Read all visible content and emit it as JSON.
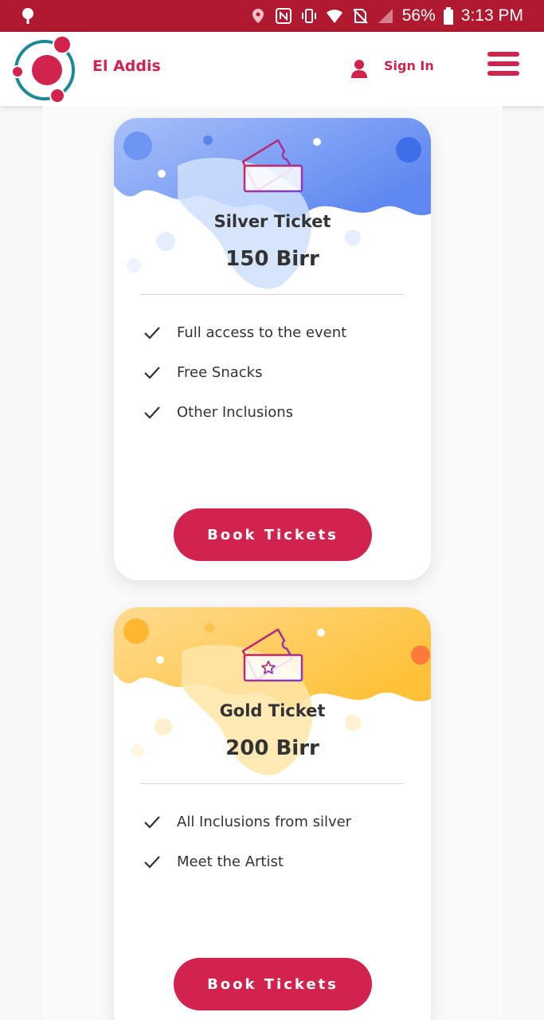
{
  "status_bar": {
    "battery": "56%",
    "time": "3:13 PM",
    "icons": [
      "pin-icon",
      "location-icon",
      "nfc-icon",
      "vibrate-icon",
      "wifi-icon",
      "no-sim-icon",
      "signal-icon",
      "battery-icon"
    ]
  },
  "navbar": {
    "brand": "El Addis",
    "sign_in": "Sign In",
    "icons": [
      "logo-icon",
      "user-icon",
      "hamburger-menu-icon"
    ]
  },
  "tickets": [
    {
      "title": "Silver Ticket",
      "price": "150 Birr",
      "features": [
        "Full access to the event",
        "Free Snacks",
        "Other Inclusions"
      ],
      "button": "Book Tickets",
      "theme": "blue",
      "icon": "ticket-icon"
    },
    {
      "title": "Gold Ticket",
      "price": "200 Birr",
      "features": [
        "All Inclusions from silver",
        "Meet the Artist"
      ],
      "button": "Book Tickets",
      "theme": "gold",
      "icon": "ticket-star-icon"
    }
  ],
  "colors": {
    "status_bar": "#b0192f",
    "accent": "#d2234f",
    "text": "#333333",
    "silver_splash": "#5b8cf0",
    "gold_splash": "#ffc23d"
  }
}
